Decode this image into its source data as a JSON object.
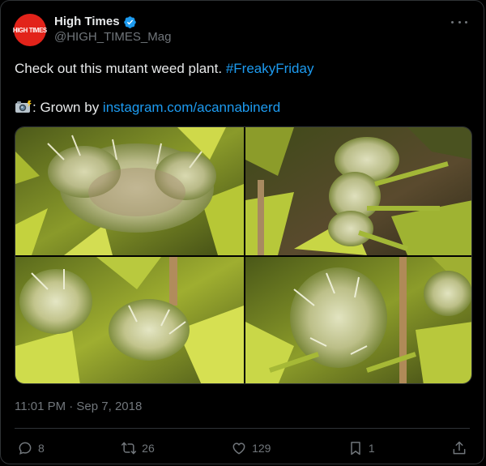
{
  "author": {
    "display_name": "High Times",
    "handle": "@HIGH_TIMES_Mag",
    "avatar_text": "HIGH TIMES",
    "verified": true
  },
  "tweet": {
    "text_line1": "Check out this mutant weed plant. ",
    "hashtag": "#FreakyFriday",
    "camera_emoji_icon": "camera-flash-icon",
    "grown_by_label": ": Grown by ",
    "credit_link": "instagram.com/acannabinerd"
  },
  "media": {
    "count": 4
  },
  "meta": {
    "timestamp": "11:01 PM · Sep 7, 2018"
  },
  "actions": {
    "replies": "8",
    "retweets": "26",
    "likes": "129",
    "bookmarks": "1"
  },
  "colors": {
    "background": "#000000",
    "text": "#e7e9ea",
    "secondary": "#71767b",
    "link": "#1d9bf0",
    "border": "#2f3336",
    "avatar": "#e2231a"
  }
}
